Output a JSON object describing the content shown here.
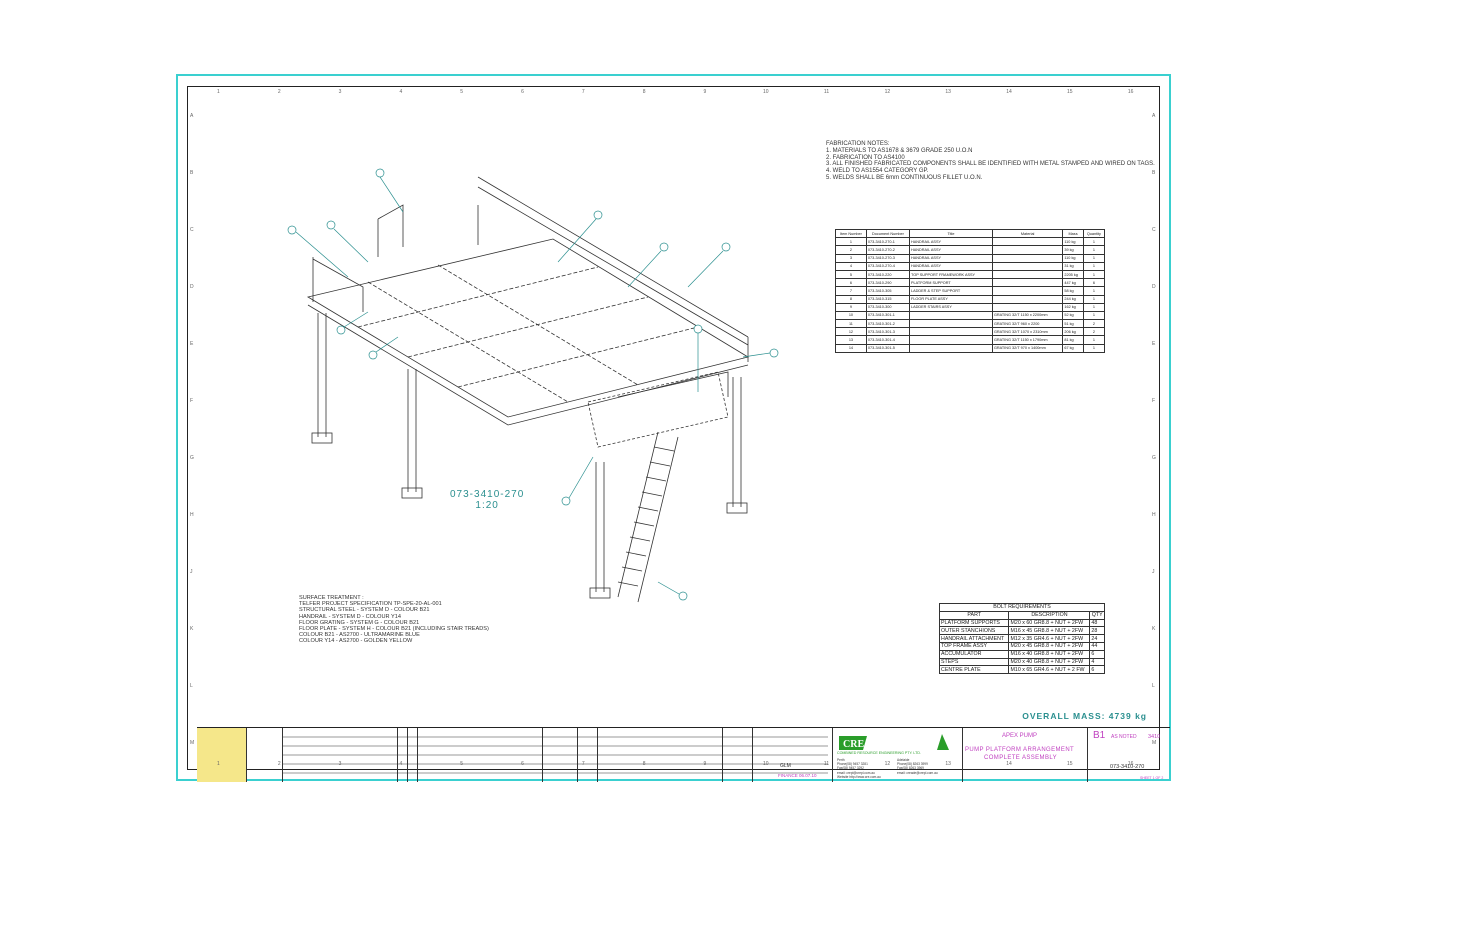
{
  "fabrication_notes": [
    "FABRICATION NOTES:",
    "1. MATERIALS TO AS1678 & 3679 GRADE 250 U.O.N",
    "2. FABRICATION TO AS4100",
    "3. ALL FINISHED FABRICATED COMPONENTS SHALL BE IDENTIFIED WITH METAL STAMPED AND WIRED ON TAGS.",
    "4. WELD TO AS1554 CATEGORY GP.",
    "5. WELDS SHALL BE 6mm CONTINUOUS FILLET U.O.N."
  ],
  "parts_table": {
    "headers": [
      "Item Number",
      "Document Number",
      "Title",
      "Material",
      "Mass",
      "Quantity"
    ],
    "rows": [
      [
        "1",
        "073-3410-270-1",
        "HANDRAIL ASSY",
        "",
        "110 kg",
        "1"
      ],
      [
        "2",
        "073-3410-270-2",
        "HANDRAIL ASSY",
        "",
        "39 kg",
        "1"
      ],
      [
        "3",
        "073-3410-270-3",
        "HANDRAIL ASSY",
        "",
        "110 kg",
        "1"
      ],
      [
        "4",
        "073-3410-270-4",
        "HANDRAIL ASSY",
        "",
        "31 kg",
        "1"
      ],
      [
        "5",
        "073-3410-220",
        "TOP SUPPORT FRAMEWORK ASSY",
        "",
        "2205 kg",
        "1"
      ],
      [
        "6",
        "073-3410-290",
        "PLATFORM SUPPORT",
        "",
        "447 kg",
        "6"
      ],
      [
        "7",
        "073-3410-305",
        "LADDER & STEP SUPPORT",
        "",
        "58 kg",
        "1"
      ],
      [
        "8",
        "073-3410-315",
        "FLOOR PLATE ASSY",
        "",
        "244 kg",
        "1"
      ],
      [
        "9",
        "073-3410-300",
        "LADDER STAIRS ASSY",
        "",
        "162 kg",
        "1"
      ],
      [
        "10",
        "073-3410-301-1",
        "",
        "GRATING 32/T 1150 x 2200mm",
        "52 kg",
        "1"
      ],
      [
        "11",
        "073-3410-301-2",
        "",
        "GRATING 32/T 960 x 2200",
        "51 kg",
        "2"
      ],
      [
        "12",
        "073-3410-301-3",
        "",
        "GRATING 32/T 1070 x 2310mm",
        "206 kg",
        "2"
      ],
      [
        "13",
        "073-3410-301-4",
        "",
        "GRATING 32/T 1150 x 1790mm",
        "81 kg",
        "1"
      ],
      [
        "14",
        "073-3410-301-5",
        "",
        "GRATING 32/T 970 x 1400mm",
        "67 kg",
        "1"
      ]
    ]
  },
  "bolt_requirements": {
    "title": "BOLT REQUIREMENTS",
    "headers": [
      "PART",
      "DESCRIPTION",
      "QTY"
    ],
    "rows": [
      [
        "PLATFORM SUPPORTS",
        "M20 x 60 GR8.8 + NUT + 2FW",
        "48"
      ],
      [
        "OUTER STANCHIONS",
        "M16 x 45 GR8.8 + NUT + 2FW",
        "28"
      ],
      [
        "HANDRAIL ATTACHMENT",
        "M12 x 35 GR4.6 + NUT + 2FW",
        "24"
      ],
      [
        "TOP FRAME ASSY",
        "M20 x 45 GR8.8 + NUT + 2FW",
        "44"
      ],
      [
        "ACCUMULATOR",
        "M16 x 40 GR8.8 + NUT + 2FW",
        "6"
      ],
      [
        "STEPS",
        "M20 x 40 GR8.8 + NUT + 2FW",
        "4"
      ],
      [
        "CENTRE PLATE",
        "M10 x 65 GR4.6 + NUT + 2 FW",
        "6"
      ]
    ]
  },
  "surface_treatment": [
    "SURFACE TREATMENT :",
    "TELFER PROJECT SPECIFICATION TP-SPE-20-AL-001",
    "STRUCTURAL STEEL - SYSTEM D - COLOUR B21",
    "HANDRAIL - SYSTEM D - COLOUR Y14",
    "FLOOR GRATING - SYSTEM G - COLOUR B21",
    "FLOOR PLATE - SYSTEM H - COLOUR B21 (INCLUDING STAIR TREADS)",
    "COLOUR B21 - AS2700 - ULTRAMARINE BLUE",
    "COLOUR Y14 - AS2700 - GOLDEN YELLOW"
  ],
  "view_label": {
    "number": "073-3410-270",
    "scale": "1:20"
  },
  "overall_mass": "OVERALL MASS: 4739 kg",
  "title_block": {
    "company": "COMBINED RESOURCE ENGINEERING PTY. LTD.",
    "contact": [
      "Perth",
      "Phone(08) 9457 3281",
      "Fax(08) 9457 3292",
      "email: crepl@crepl.com.au",
      "Website http://www.cre.com.au"
    ],
    "contact2": [
      "Adelaide",
      "Phone(08) 8263 3999",
      "Fax(08) 8263 3969",
      "email: creade@crepl.com.au"
    ],
    "project": "APEX PUMP",
    "title_line1": "PUMP PLATFORM ARRANGEMENT",
    "title_line2": "COMPLETE ASSEMBLY",
    "size": "B1",
    "scale": "AS NOTED",
    "drawing_series": "3410",
    "drawing_number": "073-3410-270",
    "sheet": "SHEET 1 OF 2",
    "drawn_by": "GLM",
    "date": "FINANCE 06.07.10"
  },
  "zones_horizontal": [
    "1",
    "2",
    "3",
    "4",
    "5",
    "6",
    "7",
    "8",
    "9",
    "10",
    "11",
    "12",
    "13",
    "14",
    "15",
    "16"
  ],
  "zones_vertical": [
    "A",
    "B",
    "C",
    "D",
    "E",
    "F",
    "G",
    "H",
    "J",
    "K",
    "L",
    "M"
  ],
  "colors": {
    "frame": "#3ad0d0",
    "teal_text": "#2a8f8f",
    "magenta": "#c040c0",
    "logo_green": "#2a9d2a",
    "logo_yellow": "#f5e78a"
  }
}
